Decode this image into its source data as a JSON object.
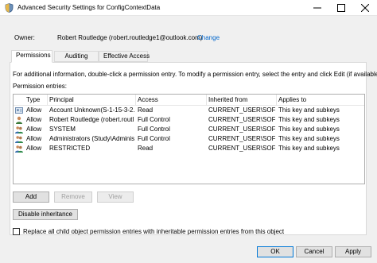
{
  "window": {
    "title": "Advanced Security Settings for ConfigContextData"
  },
  "owner": {
    "label": "Owner:",
    "value": "Robert Routledge (robert.routledge1@outlook.com)",
    "change_link": "Change"
  },
  "tabs": [
    {
      "label": "Permissions",
      "active": true
    },
    {
      "label": "Auditing",
      "active": false
    },
    {
      "label": "Effective Access",
      "active": false
    }
  ],
  "permissions": {
    "info_text": "For additional information, double-click a permission entry. To modify a permission entry, select the entry and click Edit (if available).",
    "entries_label": "Permission entries:",
    "columns": [
      "Type",
      "Principal",
      "Access",
      "Inherited from",
      "Applies to"
    ],
    "rows": [
      {
        "type": "Allow",
        "principal": "Account Unknown(S-1-15-3-2...",
        "access": "Read",
        "inherited_from": "CURRENT_USER\\SOFTW...",
        "applies_to": "This key and subkeys",
        "icon": "unknown-account-icon"
      },
      {
        "type": "Allow",
        "principal": "Robert Routledge (robert.routl...",
        "access": "Full Control",
        "inherited_from": "CURRENT_USER\\SOFTW...",
        "applies_to": "This key and subkeys",
        "icon": "user-icon"
      },
      {
        "type": "Allow",
        "principal": "SYSTEM",
        "access": "Full Control",
        "inherited_from": "CURRENT_USER\\SOFTW...",
        "applies_to": "This key and subkeys",
        "icon": "group-icon"
      },
      {
        "type": "Allow",
        "principal": "Administrators (Study\\Adminis...",
        "access": "Full Control",
        "inherited_from": "CURRENT_USER\\SOFTW...",
        "applies_to": "This key and subkeys",
        "icon": "group-icon"
      },
      {
        "type": "Allow",
        "principal": "RESTRICTED",
        "access": "Read",
        "inherited_from": "CURRENT_USER\\SOFTW...",
        "applies_to": "This key and subkeys",
        "icon": "group-icon"
      }
    ],
    "buttons": {
      "add": "Add",
      "remove": "Remove",
      "view": "View",
      "disable_inheritance": "Disable inheritance"
    },
    "replace_checkbox": {
      "label": "Replace all child object permission entries with inheritable permission entries from this object",
      "checked": false
    }
  },
  "footer": {
    "ok": "OK",
    "cancel": "Cancel",
    "apply": "Apply"
  },
  "colors": {
    "link": "#0066cc",
    "focus_border": "#0078d7",
    "dialog_background": "#f0f0f0"
  }
}
